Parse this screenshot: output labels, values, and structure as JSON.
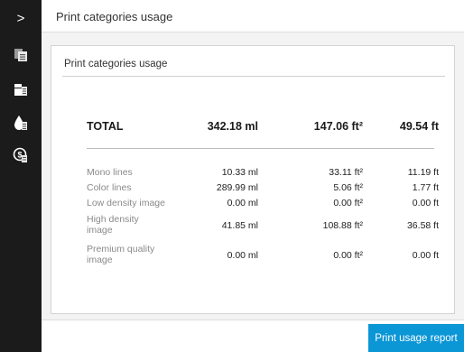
{
  "sidebar": {
    "collapse_glyph": ">",
    "items": [
      {
        "icon": "print-categories-icon",
        "active": true
      },
      {
        "icon": "print-queue-icon",
        "active": false
      },
      {
        "icon": "ink-usage-icon",
        "active": false
      },
      {
        "icon": "accounting-icon",
        "active": false
      }
    ]
  },
  "header": {
    "title": "Print categories usage"
  },
  "card": {
    "title": "Print categories usage",
    "total": {
      "label": "TOTAL",
      "ink": "342.18 ml",
      "area": "147.06 ft²",
      "length": "49.54 ft"
    },
    "rows": [
      {
        "label": "Mono lines",
        "ink": "10.33 ml",
        "area": "33.11 ft²",
        "length": "11.19 ft"
      },
      {
        "label": "Color lines",
        "ink": "289.99 ml",
        "area": "5.06 ft²",
        "length": "1.77 ft"
      },
      {
        "label": "Low density image",
        "ink": "0.00 ml",
        "area": "0.00 ft²",
        "length": "0.00 ft"
      },
      {
        "label": "High density image",
        "ink": "41.85 ml",
        "area": "108.88 ft²",
        "length": "36.58 ft"
      },
      {
        "label": "Premium quality image",
        "ink": "0.00 ml",
        "area": "0.00 ft²",
        "length": "0.00 ft"
      }
    ]
  },
  "footer": {
    "report_button": "Print usage report"
  },
  "colors": {
    "sidebar": "#1b1b1b",
    "accent": "#0b96d6",
    "background": "#f3f3f3"
  }
}
